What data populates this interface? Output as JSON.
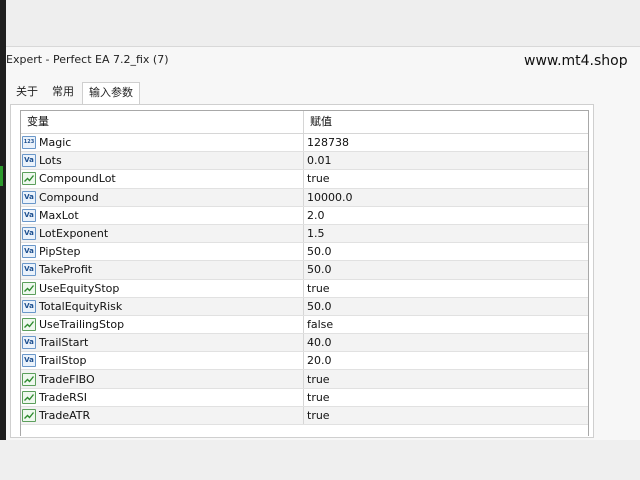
{
  "window": {
    "title": "Expert - Perfect EA 7.2_fix (7)",
    "watermark": "www.mt4.shop"
  },
  "tabs": [
    {
      "label": "关于",
      "active": false
    },
    {
      "label": "常用",
      "active": false
    },
    {
      "label": "输入参数",
      "active": true
    }
  ],
  "grid": {
    "header": {
      "name": "变量",
      "value": "赋值"
    },
    "rows": [
      {
        "name": "Magic",
        "value": "128738",
        "icon": "int-icon"
      },
      {
        "name": "Lots",
        "value": "0.01",
        "icon": "double-icon"
      },
      {
        "name": "CompoundLot",
        "value": "true",
        "icon": "bool-icon"
      },
      {
        "name": "Compound",
        "value": "10000.0",
        "icon": "double-icon"
      },
      {
        "name": "MaxLot",
        "value": "2.0",
        "icon": "double-icon"
      },
      {
        "name": "LotExponent",
        "value": "1.5",
        "icon": "double-icon"
      },
      {
        "name": "PipStep",
        "value": "50.0",
        "icon": "double-icon"
      },
      {
        "name": "TakeProfit",
        "value": "50.0",
        "icon": "double-icon"
      },
      {
        "name": "UseEquityStop",
        "value": "true",
        "icon": "bool-icon"
      },
      {
        "name": "TotalEquityRisk",
        "value": "50.0",
        "icon": "double-icon"
      },
      {
        "name": "UseTrailingStop",
        "value": "false",
        "icon": "bool-icon"
      },
      {
        "name": "TrailStart",
        "value": "40.0",
        "icon": "double-icon"
      },
      {
        "name": "TrailStop",
        "value": "20.0",
        "icon": "double-icon"
      },
      {
        "name": "TradeFIBO",
        "value": "true",
        "icon": "bool-icon"
      },
      {
        "name": "TradeRSI",
        "value": "true",
        "icon": "bool-icon"
      },
      {
        "name": "TradeATR",
        "value": "true",
        "icon": "bool-icon"
      }
    ]
  }
}
